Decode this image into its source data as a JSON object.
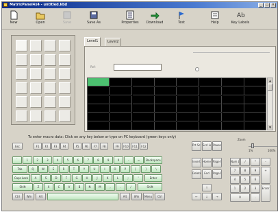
{
  "window": {
    "title": "MatrixPanel4x4 - untitled.kbd",
    "controls": [
      "_",
      "□",
      "×"
    ]
  },
  "toolbar": {
    "items": [
      {
        "label": "New",
        "icon": "new-file-icon"
      },
      {
        "label": "Open",
        "icon": "open-folder-icon"
      },
      {
        "label": "Save",
        "icon": "save-disk-icon"
      },
      {
        "label": "Save As",
        "icon": "save-as-icon"
      },
      {
        "label": "Properties",
        "icon": "properties-icon"
      },
      {
        "label": "Download",
        "icon": "download-arrow-icon"
      },
      {
        "label": "Test",
        "icon": "test-flag-icon"
      },
      {
        "label": "Help",
        "icon": "help-book-icon"
      },
      {
        "label": "Key Labels",
        "icon": "key-labels-icon"
      }
    ]
  },
  "tabs": {
    "items": [
      "Level1",
      "Level2"
    ],
    "active": "Level1"
  },
  "panel": {
    "field_label": "Ref:",
    "field_value": ""
  },
  "instruction": "To enter macro data:  Click on any key below or type on PC keyboard (green keys only)",
  "keyboard": {
    "esc": "Esc",
    "fkeys": [
      "F1",
      "F2",
      "F3",
      "F4",
      "F5",
      "F6",
      "F7",
      "F8",
      "F9",
      "F10",
      "F11",
      "F12"
    ],
    "sys": [
      "Prt Scr",
      "Scrl Lock",
      "Pause"
    ],
    "numrow": [
      "`",
      "1",
      "2",
      "3",
      "4",
      "5",
      "6",
      "7",
      "8",
      "9",
      "0",
      "-",
      "="
    ],
    "backspace": "Backspace",
    "tab": "Tab",
    "qrow": [
      "Q",
      "W",
      "E",
      "R",
      "T",
      "Y",
      "U",
      "I",
      "O",
      "P",
      "[",
      "]",
      "\\"
    ],
    "caps": "Caps Lock",
    "arow": [
      "A",
      "S",
      "D",
      "F",
      "G",
      "H",
      "J",
      "K",
      "L",
      ";",
      "'"
    ],
    "enter": "Enter",
    "lshift": "Shift",
    "zrow": [
      "Z",
      "X",
      "C",
      "V",
      "B",
      "N",
      "M",
      ",",
      ".",
      "/"
    ],
    "rshift": "Shift",
    "bottom": [
      "Ctrl",
      "Win",
      "Alt",
      "Alt",
      "Win",
      "Menu",
      "Ctrl"
    ],
    "nav": [
      "Insert",
      "Home",
      "Page Up",
      "Delete",
      "End",
      "Page Down"
    ],
    "arrows": [
      "↑",
      "←",
      "↓",
      "→"
    ],
    "numpad": [
      "Num Lock",
      "/",
      "*",
      "-",
      "7",
      "8",
      "9",
      "+",
      "4",
      "5",
      "6",
      "1",
      "2",
      "3",
      "Enter",
      "0",
      "."
    ],
    "zoom": {
      "label": "Zoom",
      "min": "1%",
      "max": "100%"
    }
  }
}
